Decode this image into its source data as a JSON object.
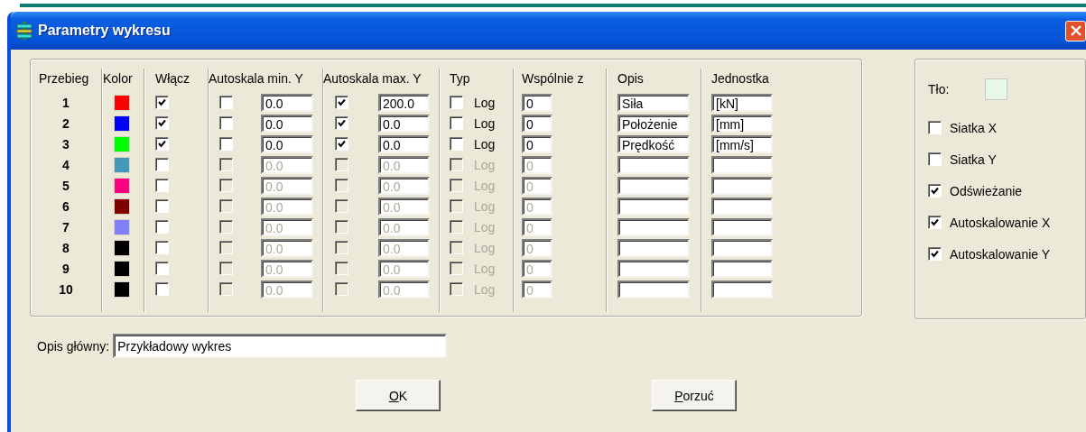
{
  "window": {
    "title": "Parametry wykresu"
  },
  "columns": {
    "run": "Przebieg",
    "swatch": "Kolor",
    "enable": "Włącz",
    "auto_min": "Autoskala min. Y",
    "auto_max": "Autoskala max. Y",
    "type": "Typ",
    "shared": "Wspólnie z",
    "description": "Opis",
    "unit": "Jednostka"
  },
  "runs": [
    {
      "number": "1",
      "color": "#ff0000",
      "enabled": true,
      "auto_min": false,
      "min": "0.0",
      "auto_max": true,
      "max": "200.0",
      "log": false,
      "log_label": "Log",
      "shared_with": "0",
      "description": "Siła",
      "unit": "[kN]"
    },
    {
      "number": "2",
      "color": "#0000ff",
      "enabled": true,
      "auto_min": false,
      "min": "0.0",
      "auto_max": true,
      "max": "0.0",
      "log": false,
      "log_label": "Log",
      "shared_with": "0",
      "description": "Położenie",
      "unit": "[mm]"
    },
    {
      "number": "3",
      "color": "#00ff00",
      "enabled": true,
      "auto_min": false,
      "min": "0.0",
      "auto_max": true,
      "max": "0.0",
      "log": false,
      "log_label": "Log",
      "shared_with": "0",
      "description": "Prędkość",
      "unit": "[mm/s]"
    },
    {
      "number": "4",
      "color": "#4499bb",
      "enabled": false,
      "auto_min": false,
      "min": "0.0",
      "auto_max": false,
      "max": "0.0",
      "log": false,
      "log_label": "Log",
      "shared_with": "0"
    },
    {
      "number": "5",
      "color": "#ff0080",
      "enabled": false,
      "auto_min": false,
      "min": "0.0",
      "auto_max": false,
      "max": "0.0",
      "log": false,
      "log_label": "Log",
      "shared_with": "0"
    },
    {
      "number": "6",
      "color": "#800000",
      "enabled": false,
      "auto_min": false,
      "min": "0.0",
      "auto_max": false,
      "max": "0.0",
      "log": false,
      "log_label": "Log",
      "shared_with": "0"
    },
    {
      "number": "7",
      "color": "#8080ff",
      "enabled": false,
      "auto_min": false,
      "min": "0.0",
      "auto_max": false,
      "max": "0.0",
      "log": false,
      "log_label": "Log",
      "shared_with": "0"
    },
    {
      "number": "8",
      "color": "#000000",
      "enabled": false,
      "auto_min": false,
      "min": "0.0",
      "auto_max": false,
      "max": "0.0",
      "log": false,
      "log_label": "Log",
      "shared_with": "0"
    },
    {
      "number": "9",
      "color": "#000000",
      "enabled": false,
      "auto_min": false,
      "min": "0.0",
      "auto_max": false,
      "max": "0.0",
      "log": false,
      "log_label": "Log",
      "shared_with": "0"
    },
    {
      "number": "10",
      "color": "#000000",
      "enabled": false,
      "auto_min": false,
      "min": "0.0",
      "auto_max": false,
      "max": "0.0",
      "log": false,
      "log_label": "Log",
      "shared_with": "0"
    }
  ],
  "side": {
    "background": {
      "label": "Tło:",
      "color": "#e8f8e8"
    },
    "options": [
      {
        "label": "Siatka X",
        "checked": false
      },
      {
        "label": "Siatka Y",
        "checked": false
      },
      {
        "label": "Odświeżanie",
        "checked": true
      },
      {
        "label": "Autoskalowanie X",
        "checked": true
      },
      {
        "label": "Autoskalowanie Y",
        "checked": true
      }
    ]
  },
  "main_description": {
    "label": "Opis główny:",
    "value": "Przykładowy wykres"
  },
  "buttons": [
    {
      "label": "OK",
      "underline_first": true
    },
    {
      "label": "Porzuć",
      "underline_first": true
    }
  ]
}
